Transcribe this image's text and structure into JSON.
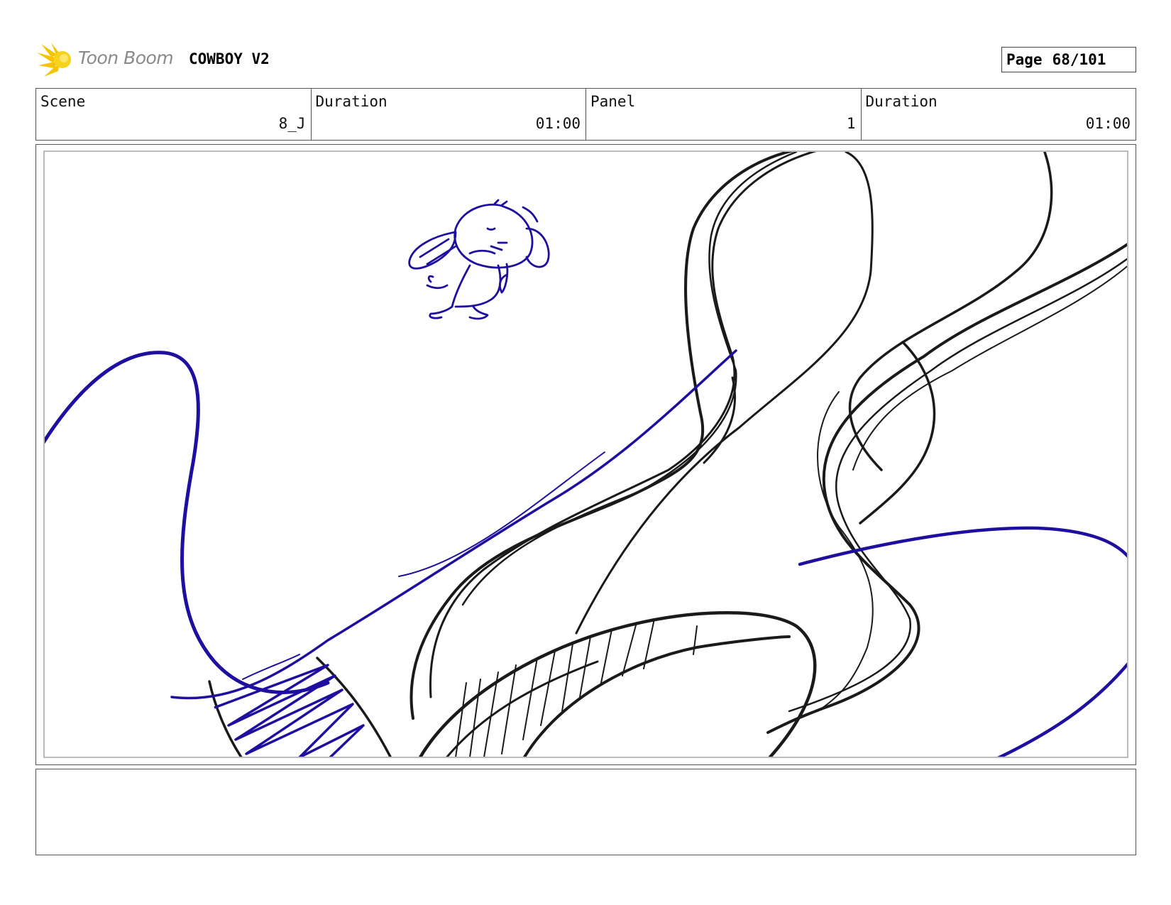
{
  "header": {
    "logo_text": "Toon Boom",
    "logo_icon": "toon-boom-burst-icon",
    "project_title": "COWBOY V2",
    "page_label": "Page",
    "page_number": "68/101"
  },
  "info": {
    "scene_label": "Scene",
    "scene_value": "8_J",
    "duration_label": "Duration",
    "duration_value": "01:00",
    "panel_label": "Panel",
    "panel_value": "1",
    "panel_duration_label": "Duration",
    "panel_duration_value": "01:00"
  },
  "colors": {
    "ink_black": "#1a1a1a",
    "ink_blue": "#1e0fa0",
    "logo_yellow": "#f5c400"
  },
  "notes": {
    "text": ""
  }
}
